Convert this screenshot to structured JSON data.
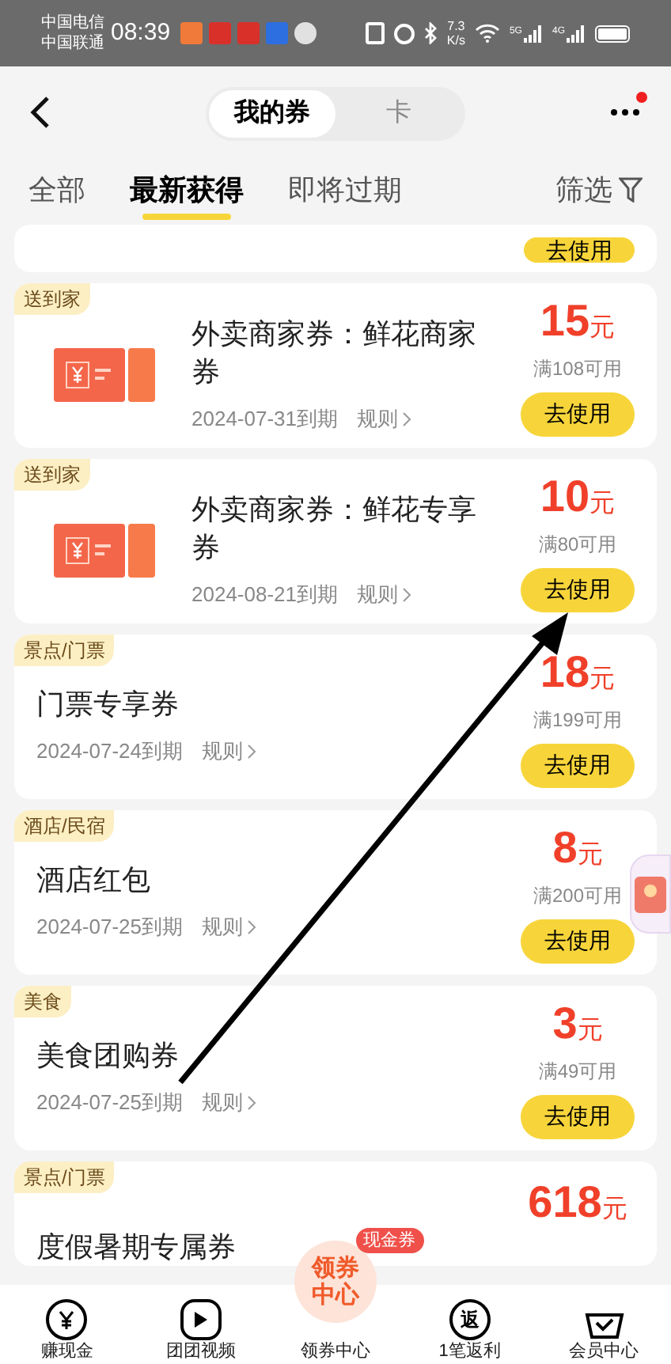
{
  "status_bar": {
    "carriers": [
      "中国电信",
      "中国联通"
    ],
    "time": "08:39",
    "speed": "7.3",
    "speed_unit": "K/s",
    "network_labels": [
      "5G",
      "4G"
    ]
  },
  "header": {
    "segments": [
      {
        "label": "我的券",
        "selected": true
      },
      {
        "label": "卡",
        "selected": false
      }
    ],
    "has_notification": true
  },
  "filter_tabs": [
    {
      "label": "全部",
      "selected": false
    },
    {
      "label": "最新获得",
      "selected": true
    },
    {
      "label": "即将过期",
      "selected": false
    }
  ],
  "filter_button": "筛选",
  "partial_card_button": "去使用",
  "coupons": [
    {
      "tag": "送到家",
      "kind": "image",
      "title": "外卖商家券：鲜花商家券",
      "expiry": "2024-07-31到期",
      "rules": "规则",
      "amount": "15",
      "unit": "元",
      "condition": "满108可用",
      "button": "去使用"
    },
    {
      "tag": "送到家",
      "kind": "image",
      "title": "外卖商家券：鲜花专享券",
      "expiry": "2024-08-21到期",
      "rules": "规则",
      "amount": "10",
      "unit": "元",
      "condition": "满80可用",
      "button": "去使用"
    },
    {
      "tag": "景点/门票",
      "kind": "plain",
      "title": "门票专享券",
      "expiry": "2024-07-24到期",
      "rules": "规则",
      "amount": "18",
      "unit": "元",
      "condition": "满199可用",
      "button": "去使用"
    },
    {
      "tag": "酒店/民宿",
      "kind": "plain",
      "title": "酒店红包",
      "expiry": "2024-07-25到期",
      "rules": "规则",
      "amount": "8",
      "unit": "元",
      "condition": "满200可用",
      "button": "去使用"
    },
    {
      "tag": "美食",
      "kind": "plain",
      "title": "美食团购券",
      "expiry": "2024-07-25到期",
      "rules": "规则",
      "amount": "3",
      "unit": "元",
      "condition": "满49可用",
      "button": "去使用"
    },
    {
      "tag": "景点/门票",
      "kind": "partial",
      "title": "度假暑期专属券",
      "amount": "618",
      "unit": "元"
    }
  ],
  "bottom_nav": [
    {
      "label": "赚现金",
      "kind": "yen"
    },
    {
      "label": "团团视频",
      "kind": "play"
    },
    {
      "label": "领券中心",
      "kind": "center",
      "circle_text": "领券中心",
      "badge": "现金券"
    },
    {
      "label": "1笔返利",
      "kind": "fan",
      "glyph": "返"
    },
    {
      "label": "会员中心",
      "kind": "basket"
    }
  ]
}
